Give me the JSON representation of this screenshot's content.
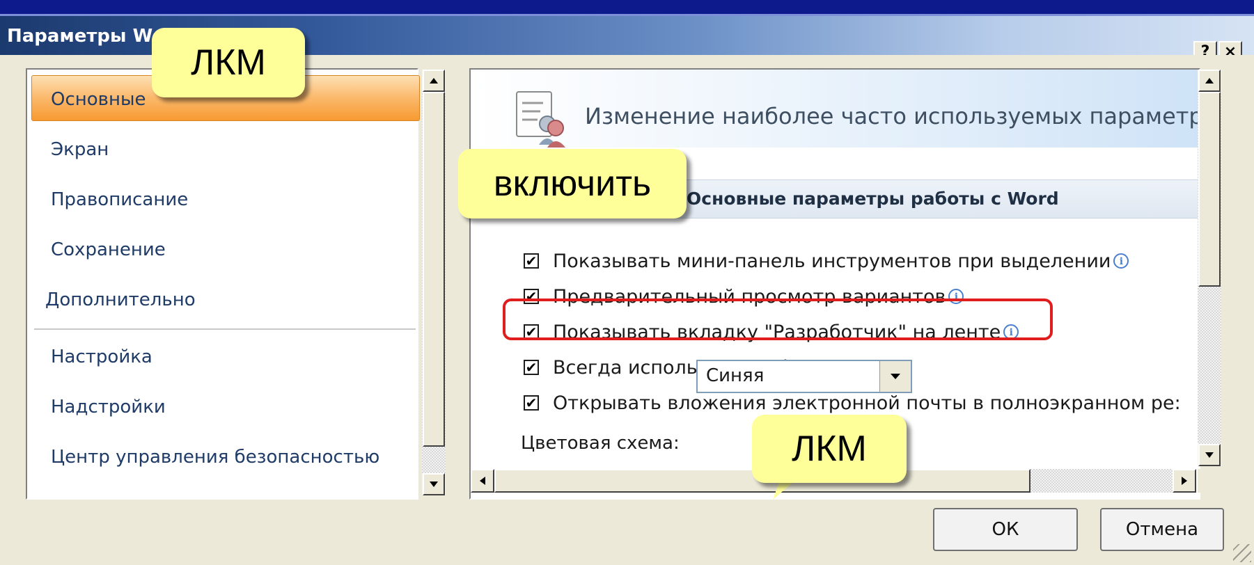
{
  "window": {
    "title": "Параметры Word",
    "help_button": "?",
    "close_button": "×"
  },
  "sidebar": {
    "items": [
      {
        "label": "Основные",
        "selected": true
      },
      {
        "label": "Экран"
      },
      {
        "label": "Правописание"
      },
      {
        "label": "Сохранение"
      },
      {
        "label": "Дополнительно"
      },
      {
        "label": "Настройка"
      },
      {
        "label": "Надстройки"
      },
      {
        "label": "Центр управления безопасностью"
      }
    ]
  },
  "main": {
    "header": "Изменение наиболее часто используемых параметров",
    "section_title": "Основные параметры работы с Word",
    "checkboxes": [
      {
        "label": "Показывать мини-панель инструментов при выделении",
        "checked": true
      },
      {
        "label": "Предварительный просмотр вариантов",
        "checked": true
      },
      {
        "label": "Показывать вкладку \"Разработчик\" на ленте",
        "checked": true
      },
      {
        "label": "Всегда использовать ClearType",
        "checked": true
      },
      {
        "label": "Открывать вложения электронной почты в полноэкранном ре:",
        "checked": true
      }
    ],
    "color_scheme": {
      "label": "Цветовая схема:",
      "value": "Синяя"
    }
  },
  "buttons": {
    "ok": "ОК",
    "cancel": "Отмена"
  },
  "callouts": {
    "top": "ЛКМ",
    "middle": "включить",
    "bottom": "ЛКМ"
  },
  "icons": {
    "header": "options-document-icon",
    "info": "info-icon",
    "dropdown": "chevron-down-icon"
  },
  "colors": {
    "highlight": "#e01e1e",
    "callout": "#ffff99",
    "selected": "#f79a32"
  }
}
